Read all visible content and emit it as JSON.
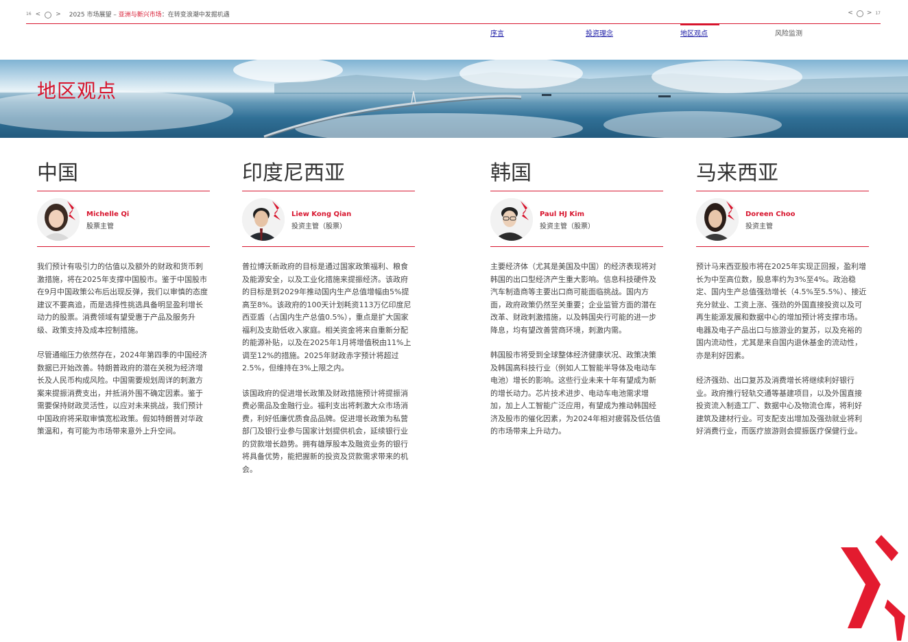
{
  "header": {
    "page_left": "16",
    "page_right": "17",
    "title_prefix": "2025 市场展望 – ",
    "title_highlight": "亚洲与新兴市场",
    "title_suffix": "：在转变浪潮中发掘机遇",
    "prev_glyph": "<",
    "next_glyph": ">"
  },
  "nav": {
    "items": [
      {
        "label": "序言"
      },
      {
        "label": "投资理念"
      },
      {
        "label": "地区观点"
      },
      {
        "label": "风险监测"
      }
    ]
  },
  "banner": {
    "title": "地区观点"
  },
  "columns": [
    {
      "region": "中国",
      "name": "Michelle Qi",
      "role": "股票主管",
      "paragraphs": [
        "我们预计有吸引力的估值以及额外的财政和货币刺激措施，将在2025年支撑中国股市。鉴于中国股市在9月中国政策公布后出现反弹，我们以审慎的态度建议不要高追，而是选择性挑选具备明显盈利增长动力的股票。消费领域有望受惠于产品及服务升级、政策支持及成本控制措施。",
        "尽管通缩压力依然存在，2024年第四季的中国经济数据已开始改善。特朗普政府的潜在关税为经济增长及人民币构成风险。中国需要规划周详的刺激方案来提振消费支出，并抵消外围不确定因素。鉴于需要保持财政灵活性，以应对未来挑战，我们预计中国政府将采取审慎宽松政策。假如特朗普对华政策温和，有可能为市场带来意外上升空间。"
      ]
    },
    {
      "region": "印度尼西亚",
      "name": "Liew Kong Qian",
      "role": "投资主管（股票）",
      "paragraphs": [
        "普拉博沃新政府的目标是通过国家政策福利、粮食及能源安全，以及工业化措施来提振经济。该政府的目标是到2029年推动国内生产总值增幅由5%提高至8%。该政府的100天计划耗资113万亿印度尼西亚盾（占国内生产总值0.5%），重点是扩大国家福利及支助低收入家庭。相关资金将来自重新分配的能源补贴，以及在2025年1月将增值税由11%上调至12%的措施。2025年财政赤字预计将超过2.5%，但维持在3%上限之内。",
        "该国政府的促进增长政策及财政措施预计将提振消费必需品及金融行业。福利支出将刺激大众市场消费，利好低廉优质食品品牌。促进增长政策为私营部门及银行业参与国家计划提供机会，延续银行业的贷款增长趋势。拥有雄厚股本及融资业务的银行将具备优势，能把握新的投资及贷款需求带来的机会。"
      ]
    },
    {
      "region": "韩国",
      "name": "Paul HJ Kim",
      "role": "投资主管（股票）",
      "paragraphs": [
        "主要经济体（尤其是美国及中国）的经济表现将对韩国的出口型经济产生重大影响。信息科技硬件及汽车制造商等主要出口商可能面临挑战。国内方面，政府政策仍然至关重要；企业监管方面的潜在改革、财政刺激措施，以及韩国央行可能的进一步降息，均有望改善营商环境，刺激内需。",
        "韩国股市将受到全球整体经济健康状况、政策决策及韩国高科技行业（例如人工智能半导体及电动车电池）增长的影响。这些行业未来十年有望成为新的增长动力。芯片技术进步、电动车电池需求增加，加上人工智能广泛应用，有望成为推动韩国经济及股市的催化因素，为2024年相对疲弱及低估值的市场带来上升动力。"
      ]
    },
    {
      "region": "马来西亚",
      "name": "Doreen Choo",
      "role": "投资主管",
      "paragraphs": [
        "预计马来西亚股市将在2025年实现正回报，盈利增长为中至高位数，股息率约为3%至4%。政治稳定、国内生产总值强劲增长（4.5%至5.5%）、接近充分就业、工资上涨、强劲的外国直接投资以及可再生能源发展和数据中心的增加预计将支撑市场。电器及电子产品出口与旅游业的复苏，以及充裕的国内流动性，尤其是来自国内退休基金的流动性，亦是利好因素。",
        "经济强劲、出口复苏及消费增长将继续利好银行业。政府推行轻轨交通等基建项目，以及外国直接投资流入制造工厂、数据中心及物流仓库，将利好建筑及建材行业。可支配支出增加及强劲就业将利好消费行业，而医疗旅游则会提振医疗保健行业。"
      ]
    }
  ],
  "colors": {
    "accent": "#d7142d"
  },
  "icons": {
    "logo": "red-chevron-logo",
    "home": "home-icon"
  }
}
